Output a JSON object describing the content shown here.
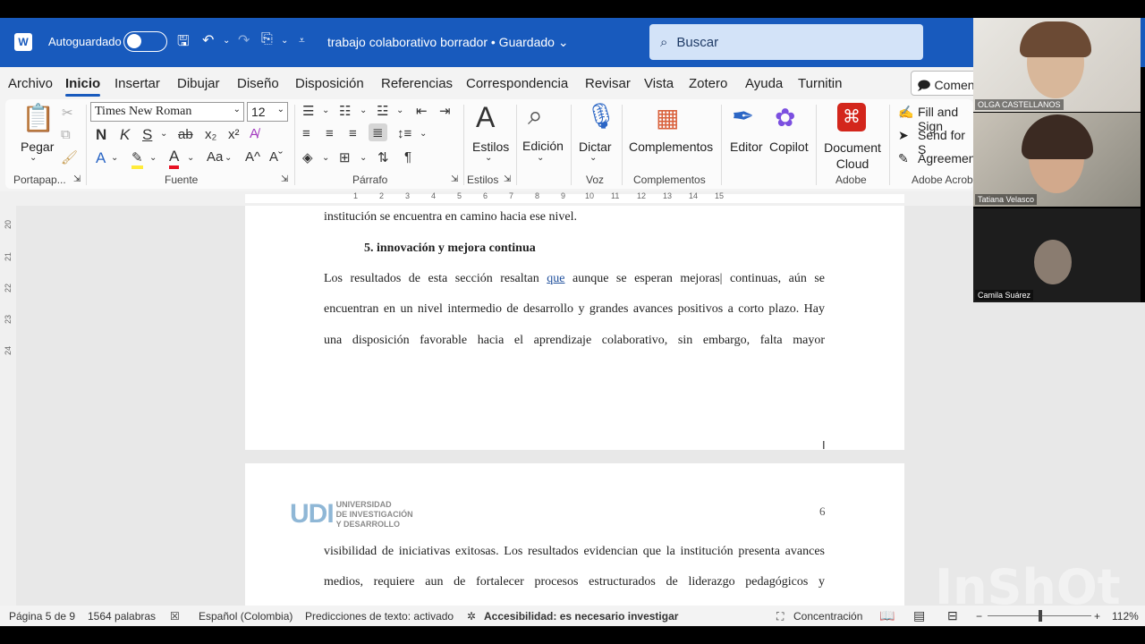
{
  "titlebar": {
    "autosave_label": "Autoguardado",
    "doc_title": "trabajo colaborativo borrador • Guardado ⌄",
    "search_placeholder": "Buscar"
  },
  "menu": {
    "items": [
      "Archivo",
      "Inicio",
      "Insertar",
      "Dibujar",
      "Diseño",
      "Disposición",
      "Referencias",
      "Correspondencia",
      "Revisar",
      "Vista",
      "Zotero",
      "Ayuda",
      "Turnitin"
    ],
    "active": "Inicio",
    "comment_label": "Comen"
  },
  "ribbon": {
    "paste_label": "Pegar",
    "font_name": "Times New Roman",
    "font_size": "12",
    "styles_label": "Estilos",
    "edit_label": "Edición",
    "dictate_label": "Dictar",
    "addins_label": "Complementos",
    "editor_label": "Editor",
    "copilot_label": "Copilot",
    "doccloud_label": "Document Cloud",
    "acrobat_items": [
      "Fill and Sign",
      "Send for S",
      "Agreemen"
    ],
    "groups": {
      "clipboard": "Portapap...",
      "font": "Fuente",
      "paragraph": "Párrafo",
      "styles": "Estilos",
      "voice": "Voz",
      "addins": "Complementos",
      "adobe": "Adobe",
      "adobe_acrobat": "Adobe Acrob"
    }
  },
  "document": {
    "page1_line0": "institución se encuentra en camino hacia ese nivel.",
    "heading": "5. innovación y mejora continua",
    "page1_line1_a": " Los resultados de esta sección resaltan ",
    "page1_line1_u": "que",
    "page1_line1_b": " aunque se esperan mejoras| continuas, aún se",
    "page1_line2": "encuentran en un nivel intermedio de desarrollo y grandes avances positivos a corto plazo. Hay",
    "page1_line3": "una disposición favorable hacia el aprendizaje colaborativo, sin embargo, falta mayor",
    "page2_number": "6",
    "logo_big": "UDI",
    "logo_line1": "UNIVERSIDAD",
    "logo_line2": "DE INVESTIGACIÓN",
    "logo_line3": "Y DESARROLLO",
    "page2_line1": "visibilidad de iniciativas exitosas. Los resultados evidencian que la institución presenta avances",
    "page2_line2": "medios, requiere aun de fortalecer procesos estructurados de liderazgo pedagógicos y"
  },
  "ruler": {
    "numbers": [
      "1",
      "2",
      "3",
      "4",
      "5",
      "6",
      "7",
      "8",
      "9",
      "10",
      "11",
      "12",
      "13",
      "14",
      "15"
    ],
    "vnumbers": [
      "20",
      "21",
      "22",
      "23",
      "24"
    ]
  },
  "statusbar": {
    "page": "Página 5 de 9",
    "words": "1564 palabras",
    "language": "Español (Colombia)",
    "predictions": "Predicciones de texto: activado",
    "accessibility": "Accesibilidad: es necesario investigar",
    "focus": "Concentración",
    "zoom": "112%"
  },
  "participants": {
    "p1": "OLGA CASTELLANOS",
    "p2": "Tatiana Velasco",
    "p3": "Camila Suárez"
  },
  "watermark": "InShOt"
}
